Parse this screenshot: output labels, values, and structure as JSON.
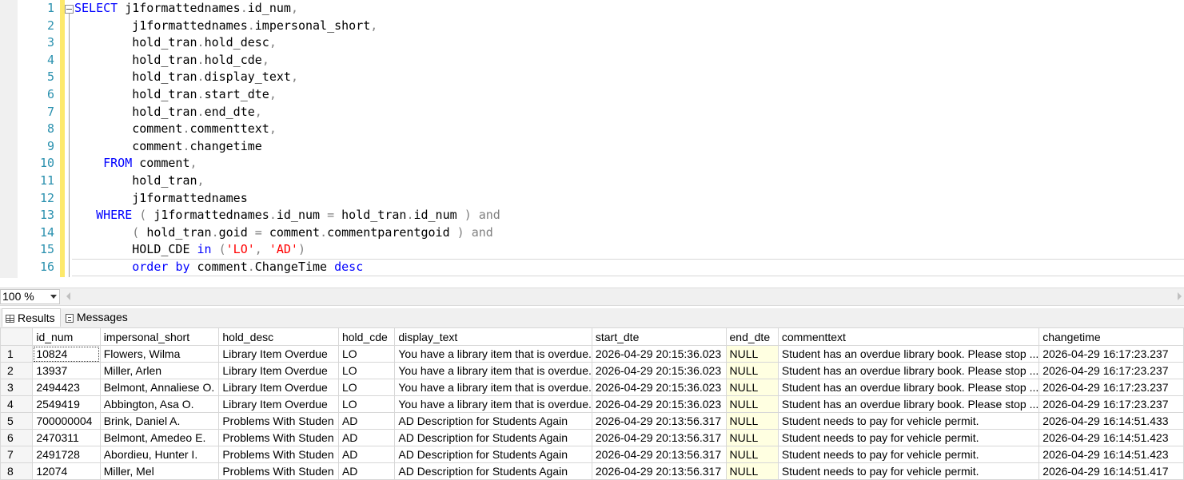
{
  "editor": {
    "line_numbers": [
      "1",
      "2",
      "3",
      "4",
      "5",
      "6",
      "7",
      "8",
      "9",
      "10",
      "11",
      "12",
      "13",
      "14",
      "15",
      "16"
    ],
    "sql_text": "SELECT j1formattednames.id_num,\n        j1formattednames.impersonal_short,\n        hold_tran.hold_desc,\n        hold_tran.hold_cde,\n        hold_tran.display_text,\n        hold_tran.start_dte,\n        hold_tran.end_dte,\n        comment.commenttext,\n        comment.changetime\n    FROM comment,\n        hold_tran,\n        j1formattednames\n   WHERE ( j1formattednames.id_num = hold_tran.id_num ) and\n        ( hold_tran.goid = comment.commentparentgoid ) and\n        HOLD_CDE in ('LO', 'AD')\n        order by comment.ChangeTime desc"
  },
  "zoom": {
    "value": "100 %"
  },
  "result_tabs": {
    "results": "Results",
    "messages": "Messages"
  },
  "results": {
    "columns": [
      "id_num",
      "impersonal_short",
      "hold_desc",
      "hold_cde",
      "display_text",
      "start_dte",
      "end_dte",
      "commenttext",
      "changetime"
    ],
    "rows": [
      [
        "1",
        "10824",
        "Flowers, Wilma",
        "Library Item Overdue",
        "LO",
        "You have a library item that is overdue.",
        "2026-04-29 20:15:36.023",
        "NULL",
        "Student has an overdue library book. Please stop ...",
        "2026-04-29 16:17:23.237"
      ],
      [
        "2",
        "13937",
        "Miller, Arlen",
        "Library Item Overdue",
        "LO",
        "You have a library item that is overdue.",
        "2026-04-29 20:15:36.023",
        "NULL",
        "Student has an overdue library book. Please stop ...",
        "2026-04-29 16:17:23.237"
      ],
      [
        "3",
        "2494423",
        "Belmont, Annaliese O.",
        "Library Item Overdue",
        "LO",
        "You have a library item that is overdue.",
        "2026-04-29 20:15:36.023",
        "NULL",
        "Student has an overdue library book. Please stop ...",
        "2026-04-29 16:17:23.237"
      ],
      [
        "4",
        "2549419",
        "Abbington, Asa O.",
        "Library Item Overdue",
        "LO",
        "You have a library item that is overdue.",
        "2026-04-29 20:15:36.023",
        "NULL",
        "Student has an overdue library book. Please stop ...",
        "2026-04-29 16:17:23.237"
      ],
      [
        "5",
        "700000004",
        "Brink, Daniel A.",
        "Problems With Studen",
        "AD",
        "AD Description for Students Again",
        "2026-04-29 20:13:56.317",
        "NULL",
        "Student needs to pay for vehicle permit.",
        "2026-04-29 16:14:51.433"
      ],
      [
        "6",
        "2470311",
        "Belmont, Amedeo E.",
        "Problems With Studen",
        "AD",
        "AD Description for Students Again",
        "2026-04-29 20:13:56.317",
        "NULL",
        "Student needs to pay for vehicle permit.",
        "2026-04-29 16:14:51.423"
      ],
      [
        "7",
        "2491728",
        "Abordieu, Hunter I.",
        "Problems With Studen",
        "AD",
        "AD Description for Students Again",
        "2026-04-29 20:13:56.317",
        "NULL",
        "Student needs to pay for vehicle permit.",
        "2026-04-29 16:14:51.423"
      ],
      [
        "8",
        "12074",
        "Miller, Mel",
        "Problems With Studen",
        "AD",
        "AD Description for Students Again",
        "2026-04-29 20:13:56.317",
        "NULL",
        "Student needs to pay for vehicle permit.",
        "2026-04-29 16:14:51.417"
      ]
    ]
  },
  "colors": {
    "keyword": "#0000ff",
    "operator": "#808080",
    "string": "#ff0000",
    "line_number": "#2b91af",
    "change_bar": "#fde96a",
    "null_cell": "#ffffe1"
  }
}
